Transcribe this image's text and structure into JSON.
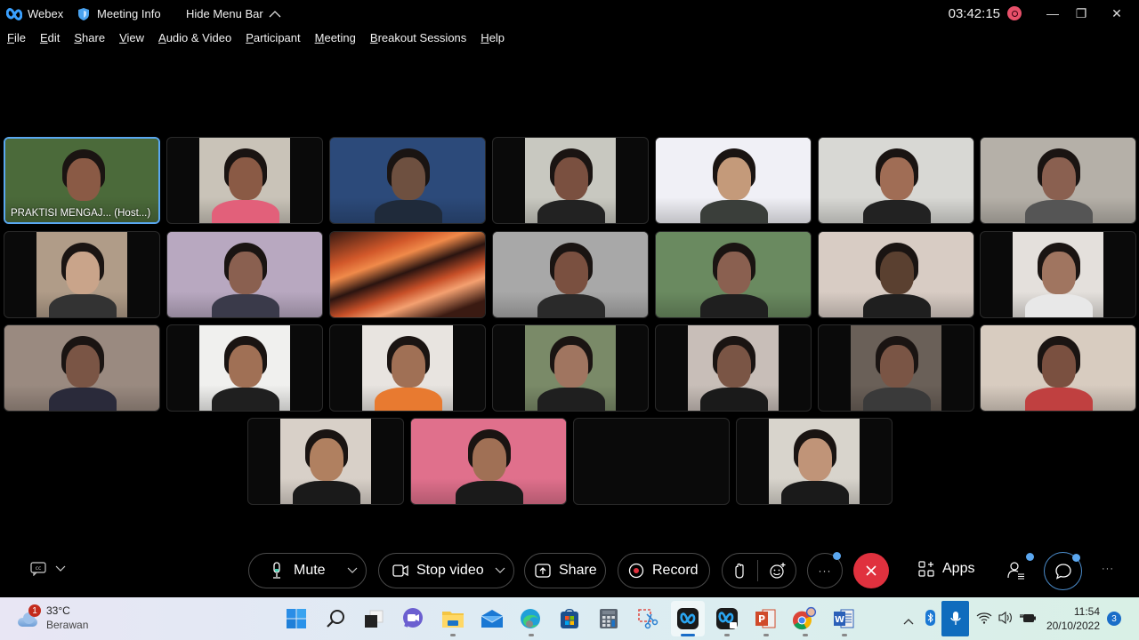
{
  "titlebar": {
    "app_name": "Webex",
    "meeting_info": "Meeting Info",
    "hide_menu_bar": "Hide Menu Bar",
    "timer": "03:42:15",
    "minimize": "—",
    "restore": "❐",
    "close": "✕"
  },
  "menu": [
    {
      "u": "F",
      "rest": "ile"
    },
    {
      "u": "E",
      "rest": "dit"
    },
    {
      "u": "S",
      "rest": "hare"
    },
    {
      "u": "V",
      "rest": "iew"
    },
    {
      "u": "A",
      "rest": "udio & Video"
    },
    {
      "u": "P",
      "rest": "articipant"
    },
    {
      "u": "M",
      "rest": "eeting"
    },
    {
      "u": "B",
      "rest": "reakout Sessions"
    },
    {
      "u": "H",
      "rest": "elp"
    }
  ],
  "participants": [
    {
      "name": "PRAKTISI MENGAJ... (Host...)",
      "active": true,
      "bg": "#4b6a3a",
      "accent": "#d9a227",
      "skin": "#8a5a45",
      "narrow": false,
      "show_label": true
    },
    {
      "name": "",
      "bg": "#c9c3b8",
      "skin": "#8a5a45",
      "shirt": "#e2607a",
      "narrow": true
    },
    {
      "name": "",
      "bg": "#2c4a7a",
      "skin": "#6e5040",
      "shirt": "#1f2a3a",
      "narrow": false
    },
    {
      "name": "",
      "bg": "#c8c8c0",
      "skin": "#7a5040",
      "shirt": "#222",
      "narrow": true
    },
    {
      "name": "",
      "bg": "#f0f0f6",
      "skin": "#c49a7a",
      "shirt": "#3a3e3a",
      "narrow": false
    },
    {
      "name": "",
      "bg": "#d8d8d4",
      "skin": "#a06d55",
      "shirt": "#222",
      "narrow": false
    },
    {
      "name": "",
      "bg": "#b5b0a8",
      "skin": "#8a6050",
      "shirt": "#555",
      "narrow": false
    },
    {
      "name": "",
      "bg": "#b09c88",
      "skin": "#c9a48a",
      "shirt": "#333",
      "narrow": true
    },
    {
      "name": "",
      "bg": "#b8a8c0",
      "skin": "#8a6050",
      "shirt": "#3a3a4a",
      "narrow": false
    },
    {
      "name": "",
      "bg": "#c2502a",
      "skin": "",
      "shirt": "",
      "narrow": false,
      "pattern": "abstract"
    },
    {
      "name": "",
      "bg": "#a8a8a8",
      "skin": "#7a5040",
      "shirt": "#2a2a2a",
      "narrow": false
    },
    {
      "name": "",
      "bg": "#6a8a60",
      "skin": "#8a6050",
      "shirt": "#1f1f1f",
      "narrow": false
    },
    {
      "name": "",
      "bg": "#d8ccc4",
      "skin": "#5a4030",
      "shirt": "#1f1f1f",
      "narrow": false
    },
    {
      "name": "",
      "bg": "#e4e0dc",
      "skin": "#a07560",
      "shirt": "#e8e8e8",
      "narrow": true
    },
    {
      "name": "",
      "bg": "#9a8a80",
      "skin": "#7a5545",
      "shirt": "#2a2a3a",
      "narrow": false
    },
    {
      "name": "",
      "bg": "#f0f0ee",
      "skin": "#a07055",
      "shirt": "#1f1f1f",
      "narrow": true
    },
    {
      "name": "",
      "bg": "#e8e4e0",
      "skin": "#a07055",
      "shirt": "#e87a30",
      "narrow": true
    },
    {
      "name": "",
      "bg": "#7a8a68",
      "skin": "#a07560",
      "shirt": "#1f1f1f",
      "narrow": true
    },
    {
      "name": "",
      "bg": "#c8beb8",
      "skin": "#7a5545",
      "shirt": "#1a1a1a",
      "narrow": true
    },
    {
      "name": "",
      "bg": "#6a6058",
      "skin": "#7a5545",
      "shirt": "#3a3a3a",
      "narrow": true
    },
    {
      "name": "",
      "bg": "#d8ccc0",
      "skin": "#7a5040",
      "shirt": "#c04040",
      "narrow": false
    },
    {
      "name": "",
      "bg": "#d8d0c8",
      "skin": "#b08060",
      "shirt": "#1a1a1a",
      "narrow": true
    },
    {
      "name": "",
      "bg": "#e0708c",
      "skin": "#a07055",
      "shirt": "#1a1a1a",
      "narrow": false
    },
    {
      "name": "",
      "bg": "#000000",
      "skin": "",
      "shirt": "",
      "narrow": false,
      "blank": true
    },
    {
      "name": "",
      "bg": "#d8d4cc",
      "skin": "#c09478",
      "shirt": "#1a1a1a",
      "narrow": true
    }
  ],
  "controls": {
    "mute": "Mute",
    "stop_video": "Stop video",
    "share": "Share",
    "record": "Record",
    "apps": "Apps",
    "more": "···",
    "overflow": "···"
  },
  "taskbar": {
    "weather_temp": "33°C",
    "weather_cond": "Berawan",
    "weather_badge": "1",
    "time": "11:54",
    "date": "20/10/2022",
    "notifications": "3"
  },
  "colors": {
    "accent": "#5aa7f0",
    "end_call": "#e0313e",
    "record_dot": "#e8506a"
  }
}
